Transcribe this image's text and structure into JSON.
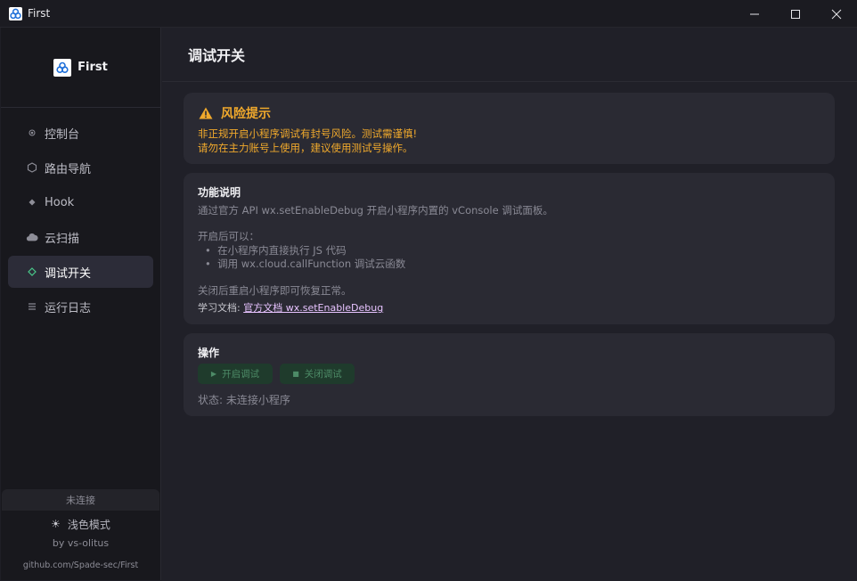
{
  "window": {
    "title": "First"
  },
  "sidebar": {
    "brand": "First",
    "items": [
      {
        "label": "控制台",
        "icon": "dot-icon"
      },
      {
        "label": "路由导航",
        "icon": "hexagon-icon"
      },
      {
        "label": "Hook",
        "icon": "diamond-small-icon"
      },
      {
        "label": "云扫描",
        "icon": "cloud-icon"
      },
      {
        "label": "调试开关",
        "icon": "diamond-outline-icon",
        "active": true
      },
      {
        "label": "运行日志",
        "icon": "list-icon"
      }
    ],
    "connection_status": "未连接",
    "theme_toggle": "浅色模式",
    "byline": "by vs-olitus",
    "github": "github.com/Spade-sec/First"
  },
  "main": {
    "title": "调试开关",
    "warning": {
      "title": "风险提示",
      "line1": "非正规开启小程序调试有封号风险。测试需谨慎!",
      "line2": "请勿在主力账号上使用，建议使用测试号操作。"
    },
    "info": {
      "title": "功能说明",
      "desc": "通过官方 API wx.setEnableDebug 开启小程序内置的 vConsole 调试面板。",
      "after_label": "开启后可以：",
      "bullets": [
        "在小程序内直接执行 JS 代码",
        "调用 wx.cloud.callFunction 调试云函数"
      ],
      "restore": "关闭后重启小程序即可恢复正常。",
      "doc_label": "学习文档:",
      "doc_link": "官方文档 wx.setEnableDebug"
    },
    "ops": {
      "title": "操作",
      "enable_label": "开启调试",
      "disable_label": "关闭调试",
      "status": "状态: 未连接小程序"
    }
  },
  "colors": {
    "accent_green": "#49c98a",
    "warning_orange": "#f0a92c",
    "link_pink": "#e7c3ff"
  }
}
